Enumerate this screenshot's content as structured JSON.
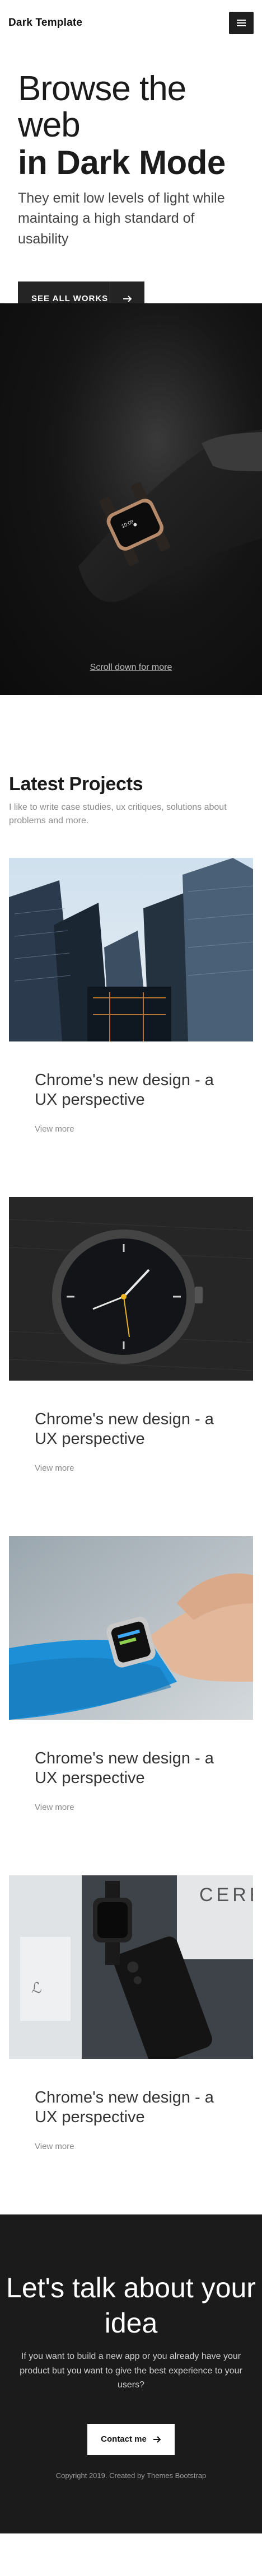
{
  "navbar": {
    "brand": "Dark Template",
    "menu_icon": "hamburger-menu-icon"
  },
  "hero": {
    "line1": "Browse the web",
    "line2": "in Dark Mode",
    "subtitle": "They emit low levels of light while maintaing a high standard of usability",
    "cta_label": "SEE ALL WORKS",
    "cta_icon": "arrow-right-icon"
  },
  "feature": {
    "scroll_link": "Scroll down for more"
  },
  "projects": {
    "title": "Latest Projects",
    "description": "I like to write case studies, ux critiques, solutions about problems and more.",
    "cards": [
      {
        "image": "skyscrapers-photo",
        "title": "Chrome's new design - a UX perspective",
        "link": "View more"
      },
      {
        "image": "watch-face-photo",
        "title": "Chrome's new design - a UX perspective",
        "link": "View more"
      },
      {
        "image": "smartwatch-wrist-photo",
        "title": "Chrome's new design - a UX perspective",
        "link": "View more"
      },
      {
        "image": "phone-and-watch-photo",
        "title": "Chrome's new design - a UX perspective",
        "link": "View more"
      }
    ]
  },
  "footer": {
    "title": "Let's talk about your idea",
    "text": "If you want to build a new app or you already have your product but you want to give the best experience to your users?",
    "contact_label": "Contact me",
    "contact_icon": "arrow-right-icon",
    "copyright": "Copyright 2019. Created by Themes Bootstrap"
  },
  "colors": {
    "dark": "#1b1b1b",
    "button_dark": "#242424",
    "muted_text": "#8a8a8a"
  }
}
